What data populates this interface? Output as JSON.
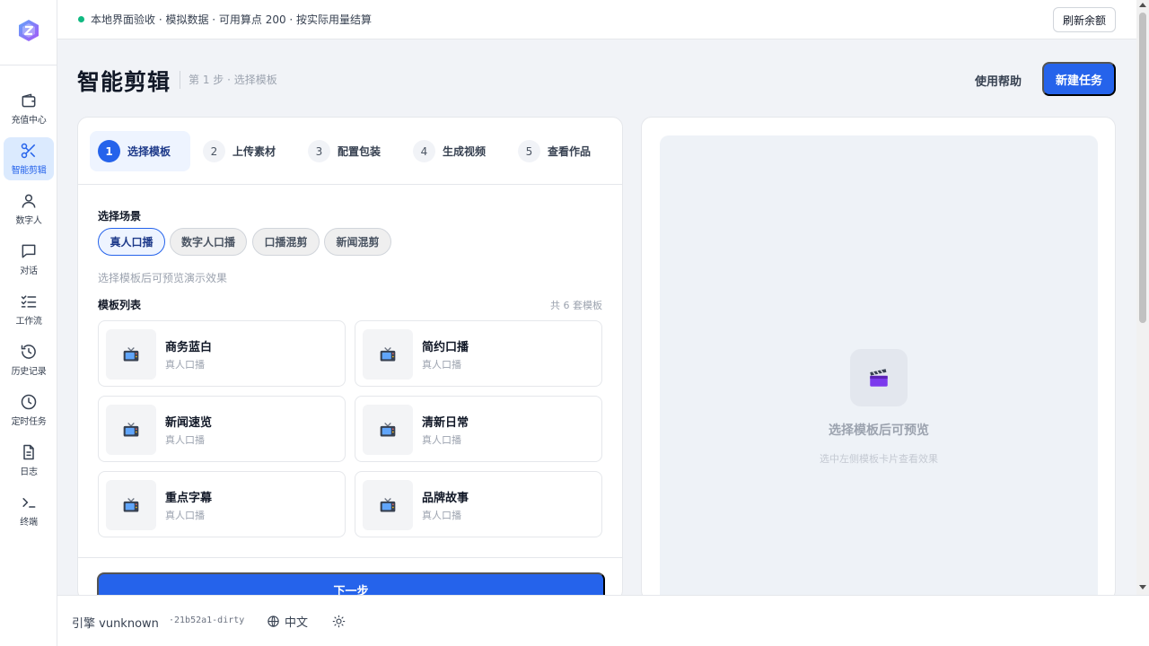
{
  "sidebar": {
    "items": [
      {
        "label": "充值中心",
        "icon": "wallet-icon"
      },
      {
        "label": "智能剪辑",
        "icon": "scissors-icon",
        "active": true
      },
      {
        "label": "数字人",
        "icon": "user-icon"
      },
      {
        "label": "对话",
        "icon": "chat-icon"
      },
      {
        "label": "工作流",
        "icon": "checklist-icon"
      },
      {
        "label": "历史记录",
        "icon": "history-icon"
      },
      {
        "label": "定时任务",
        "icon": "clock-icon"
      },
      {
        "label": "日志",
        "icon": "document-icon"
      },
      {
        "label": "终端",
        "icon": "terminal-icon"
      }
    ]
  },
  "topbar": {
    "status": "本地界面验收 · 模拟数据 · 可用算点 200 · 按实际用量结算",
    "refresh_label": "刷新余额"
  },
  "header": {
    "title": "智能剪辑",
    "subtitle": "第 1 步 · 选择模板",
    "help_label": "使用帮助",
    "new_task_label": "新建任务"
  },
  "steps": [
    {
      "num": "1",
      "label": "选择模板",
      "active": true
    },
    {
      "num": "2",
      "label": "上传素材"
    },
    {
      "num": "3",
      "label": "配置包装"
    },
    {
      "num": "4",
      "label": "生成视频"
    },
    {
      "num": "5",
      "label": "查看作品"
    }
  ],
  "scene": {
    "label": "选择场景",
    "chips": [
      "真人口播",
      "数字人口播",
      "口播混剪",
      "新闻混剪"
    ],
    "selected": "真人口播",
    "hint": "选择模板后可预览演示效果"
  },
  "templates": {
    "label": "模板列表",
    "count": "共 6 套模板",
    "items": [
      {
        "name": "商务蓝白",
        "sub": "真人口播"
      },
      {
        "name": "简约口播",
        "sub": "真人口播"
      },
      {
        "name": "新闻速览",
        "sub": "真人口播"
      },
      {
        "name": "清新日常",
        "sub": "真人口播"
      },
      {
        "name": "重点字幕",
        "sub": "真人口播"
      },
      {
        "name": "品牌故事",
        "sub": "真人口播"
      }
    ],
    "thumb_icon": "tv-icon"
  },
  "next_label": "下一步",
  "preview": {
    "icon": "clapper-icon",
    "title": "选择模板后可预览",
    "sub": "选中左侧模板卡片查看效果"
  },
  "footer": {
    "brand": "引擎 vunknown",
    "version": "·21b52a1-dirty",
    "language": "中文"
  },
  "colors": {
    "accent": "#2563eb",
    "status_ok": "#10b981"
  }
}
